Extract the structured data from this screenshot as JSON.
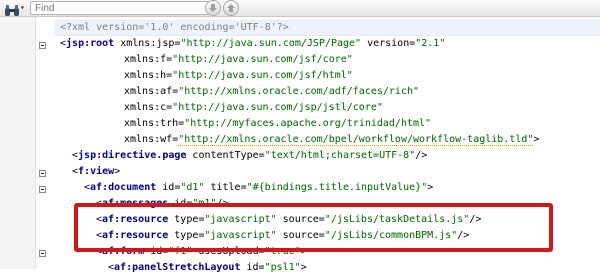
{
  "toolbar": {
    "find_placeholder": "Find",
    "search_icon": "binoculars-icon",
    "prev_icon": "arrow-down-icon",
    "next_icon": "arrow-up-icon"
  },
  "editor": {
    "lines": [
      [
        {
          "t": "pi",
          "v": "<?xml version='1.0' encoding='UTF-8'?>"
        }
      ],
      [
        {
          "t": "punct",
          "v": "<"
        },
        {
          "t": "tag",
          "v": "jsp:root"
        },
        {
          "t": "attr",
          "v": " xmlns:jsp="
        },
        {
          "t": "val",
          "v": "\"http://java.sun.com/JSP/Page\""
        },
        {
          "t": "attr",
          "v": " version="
        },
        {
          "t": "val",
          "v": "\"2.1\""
        }
      ],
      [
        {
          "t": "attr",
          "v": "xmlns:f="
        },
        {
          "t": "val",
          "v": "\"http://java.sun.com/jsf/core\""
        }
      ],
      [
        {
          "t": "attr",
          "v": "xmlns:h="
        },
        {
          "t": "val",
          "v": "\"http://java.sun.com/jsf/html\""
        }
      ],
      [
        {
          "t": "attr",
          "v": "xmlns:af="
        },
        {
          "t": "val",
          "v": "\"http://xmlns.oracle.com/adf/faces/rich\""
        }
      ],
      [
        {
          "t": "attr",
          "v": "xmlns:c="
        },
        {
          "t": "val",
          "v": "\"http://java.sun.com/jsp/jstl/core\""
        }
      ],
      [
        {
          "t": "attr",
          "v": "xmlns:trh="
        },
        {
          "t": "val",
          "v": "\"http://myfaces.apache.org/trinidad/html\""
        }
      ],
      [
        {
          "t": "attr",
          "v": "xmlns:wf="
        },
        {
          "t": "val",
          "v": "\"http://xmlns.oracle.com/bpel/workflow/workflow-taglib.tld\""
        },
        {
          "t": "punct",
          "v": ">"
        }
      ],
      [
        {
          "t": "punct",
          "v": "<"
        },
        {
          "t": "tag",
          "v": "jsp:directive.page"
        },
        {
          "t": "attr",
          "v": " contentType="
        },
        {
          "t": "val",
          "v": "\"text/html;charset=UTF-8\""
        },
        {
          "t": "punct",
          "v": "/>"
        }
      ],
      [
        {
          "t": "punct",
          "v": "<"
        },
        {
          "t": "tag",
          "v": "f:view"
        },
        {
          "t": "punct",
          "v": ">"
        }
      ],
      [
        {
          "t": "punct",
          "v": "<"
        },
        {
          "t": "tag",
          "v": "af:document"
        },
        {
          "t": "attr",
          "v": " id="
        },
        {
          "t": "val",
          "v": "\"d1\""
        },
        {
          "t": "attr",
          "v": " title="
        },
        {
          "t": "val",
          "v": "\"#{bindings.title.inputValue}\""
        },
        {
          "t": "punct",
          "v": ">"
        }
      ],
      [
        {
          "t": "punct",
          "v": "<"
        },
        {
          "t": "tag",
          "v": "af:messages"
        },
        {
          "t": "attr",
          "v": " id="
        },
        {
          "t": "val",
          "v": "\"m1\""
        },
        {
          "t": "punct",
          "v": "/>"
        }
      ],
      [
        {
          "t": "punct",
          "v": "<"
        },
        {
          "t": "tag",
          "v": "af:resource"
        },
        {
          "t": "attr",
          "v": " type="
        },
        {
          "t": "val",
          "v": "\"javascript\""
        },
        {
          "t": "attr",
          "v": " source="
        },
        {
          "t": "val",
          "v": "\"/jsLibs/taskDetails.js\""
        },
        {
          "t": "punct",
          "v": "/>"
        }
      ],
      [
        {
          "t": "punct",
          "v": "<"
        },
        {
          "t": "tag",
          "v": "af:resource"
        },
        {
          "t": "attr",
          "v": " type="
        },
        {
          "t": "val",
          "v": "\"javascript\""
        },
        {
          "t": "attr",
          "v": " source="
        },
        {
          "t": "val",
          "v": "\"/jsLibs/commonBPM.js\""
        },
        {
          "t": "punct",
          "v": "/>"
        }
      ],
      [
        {
          "t": "punct",
          "v": "<"
        },
        {
          "t": "tag",
          "v": "af:form"
        },
        {
          "t": "attr",
          "v": " id="
        },
        {
          "t": "val",
          "v": "\"f1\""
        },
        {
          "t": "attr",
          "v": " usesUpload="
        },
        {
          "t": "val",
          "v": "\"true\""
        },
        {
          "t": "punct",
          "v": ">"
        }
      ],
      [
        {
          "t": "punct",
          "v": "<"
        },
        {
          "t": "tag",
          "v": "af:panelStretchLayout"
        },
        {
          "t": "attr",
          "v": " id="
        },
        {
          "t": "val",
          "v": "\"psl1\""
        },
        {
          "t": "punct",
          "v": ">"
        }
      ]
    ]
  },
  "annotation": {
    "highlight_color": "#d01818"
  }
}
